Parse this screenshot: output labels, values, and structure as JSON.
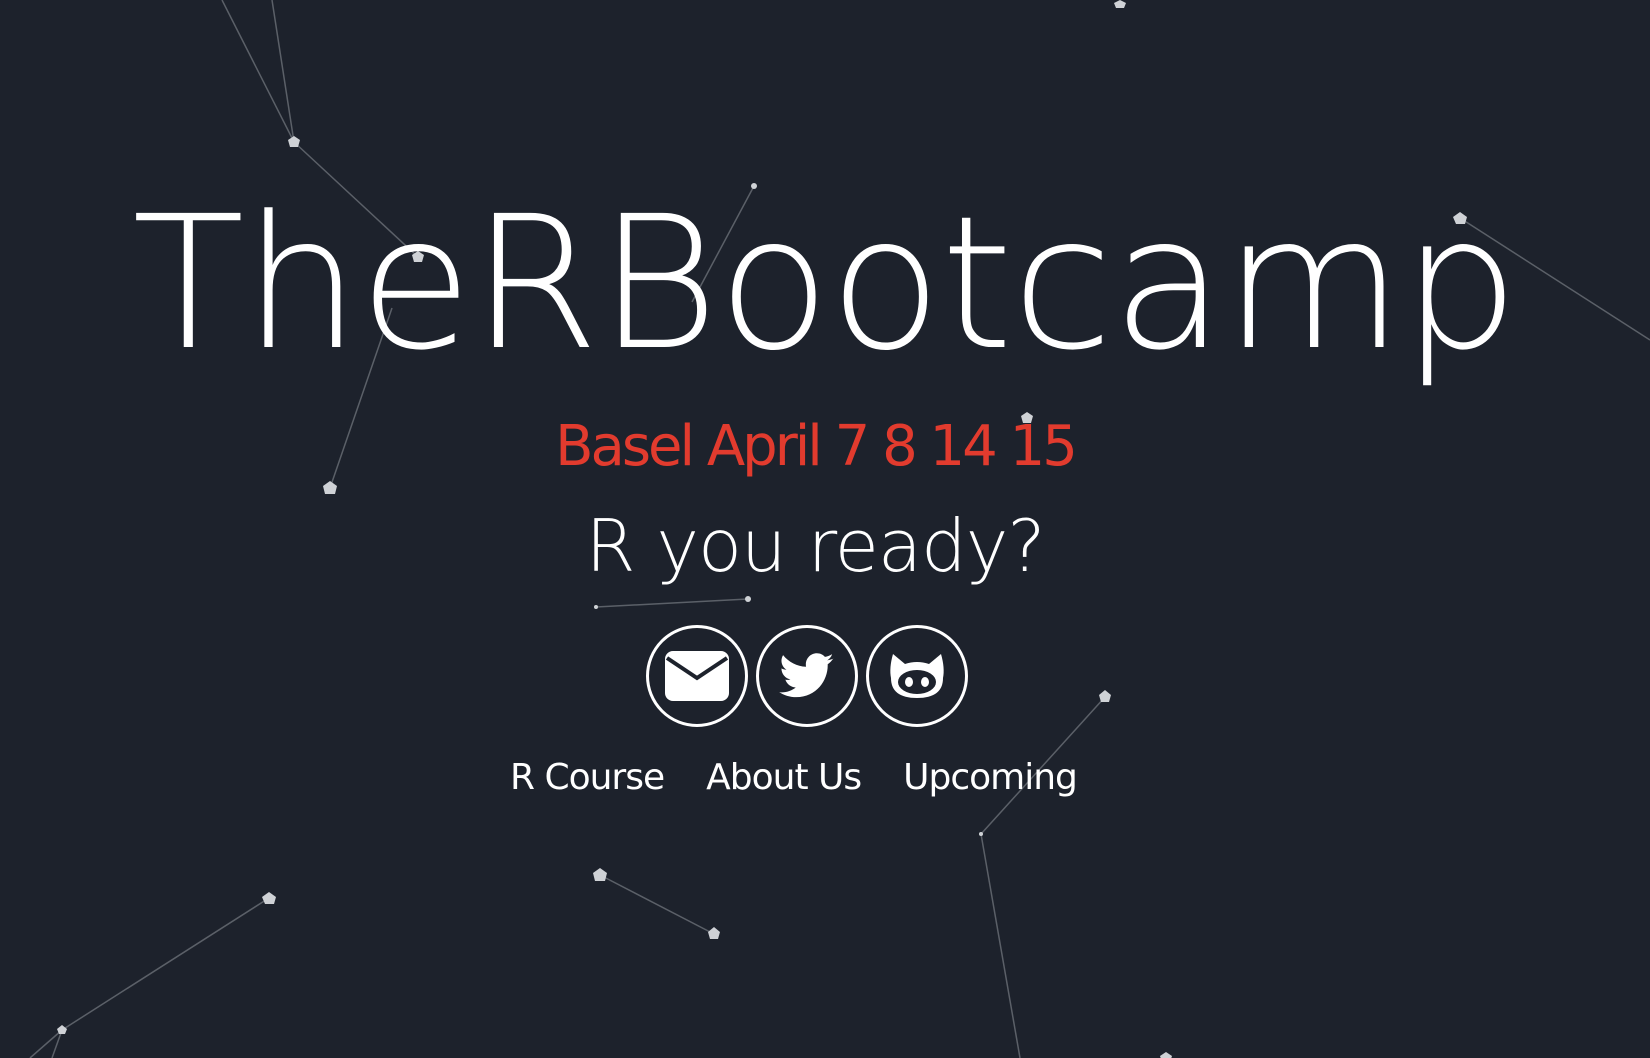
{
  "hero": {
    "title": "TheRBootcamp",
    "subtitle": "Basel April 7 8 14 15",
    "tagline": "R you ready?"
  },
  "social": [
    {
      "icon": "envelope-icon",
      "label": "email"
    },
    {
      "icon": "twitter-icon",
      "label": "twitter"
    },
    {
      "icon": "github-icon",
      "label": "github"
    }
  ],
  "nav": {
    "items": [
      {
        "label": "R Course"
      },
      {
        "label": "About Us"
      },
      {
        "label": "Upcoming"
      }
    ]
  },
  "colors": {
    "background": "#1d222c",
    "accent": "#e23b2e",
    "text": "#ffffff",
    "particle": "#cfd2d6",
    "link-line": "#5b6068"
  }
}
